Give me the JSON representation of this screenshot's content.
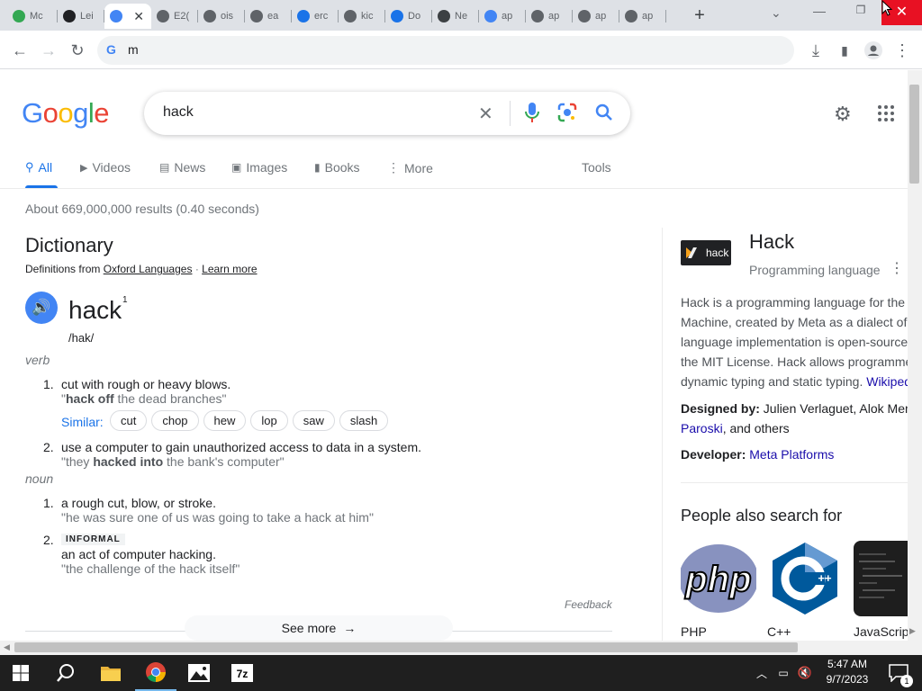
{
  "browser": {
    "tabs": [
      {
        "label": "Mc",
        "color": "#34a853"
      },
      {
        "label": "Lei",
        "color": "#202124"
      },
      {
        "label": "",
        "color": "#4285f4",
        "active": true
      },
      {
        "label": "E2(",
        "color": "#5f6368"
      },
      {
        "label": "ois",
        "color": "#5f6368"
      },
      {
        "label": "ea",
        "color": "#5f6368"
      },
      {
        "label": "erc",
        "color": "#1a73e8"
      },
      {
        "label": "kic",
        "color": "#5f6368"
      },
      {
        "label": "Do",
        "color": "#1a73e8"
      },
      {
        "label": "Ne",
        "color": "#3c4043"
      },
      {
        "label": "ap",
        "color": "#4285f4"
      },
      {
        "label": "ap",
        "color": "#5f6368"
      },
      {
        "label": "ap",
        "color": "#5f6368"
      },
      {
        "label": "ap",
        "color": "#5f6368"
      }
    ],
    "new_tab": "+",
    "close_tab": "✕",
    "omnibox_text": "m"
  },
  "search": {
    "logo": [
      "G",
      "o",
      "o",
      "g",
      "l",
      "e"
    ],
    "logo_colors": [
      "#4285f4",
      "#ea4335",
      "#fbbc05",
      "#4285f4",
      "#34a853",
      "#ea4335"
    ],
    "query": "hack",
    "tabs": [
      "All",
      "Videos",
      "News",
      "Images",
      "Books",
      "More"
    ],
    "tools": "Tools",
    "stats": "About 669,000,000 results (0.40 seconds)"
  },
  "dictionary": {
    "title": "Dictionary",
    "defs_from": "Definitions from",
    "source": "Oxford Languages",
    "learn_more": "Learn more",
    "word": "hack",
    "sup": "1",
    "phonetic": "/hak/",
    "verb_label": "verb",
    "verb_defs": [
      {
        "num": "1.",
        "def": "cut with rough or heavy blows.",
        "ex_pre": "\"",
        "ex_bold": "hack off",
        "ex_post": " the dead branches\""
      },
      {
        "num": "2.",
        "def": "use a computer to gain unauthorized access to data in a system.",
        "ex_pre": "\"they ",
        "ex_bold": "hacked into",
        "ex_post": " the bank's computer\""
      }
    ],
    "similar_label": "Similar:",
    "similar": [
      "cut",
      "chop",
      "hew",
      "lop",
      "saw",
      "slash"
    ],
    "noun_label": "noun",
    "noun_defs": [
      {
        "num": "1.",
        "def": "a rough cut, blow, or stroke.",
        "ex": "\"he was sure one of us was going to take a hack at him\""
      },
      {
        "num": "2.",
        "tag": "INFORMAL",
        "def": "an act of computer hacking.",
        "ex": "\"the challenge of the hack itself\""
      }
    ],
    "feedback": "Feedback",
    "see_more": "See more"
  },
  "knowledge_panel": {
    "logo_text": "hack",
    "title": "Hack",
    "subtitle": "Programming language",
    "desc": [
      "Hack is a programming language for the",
      "Machine, created by Meta as a dialect of",
      "language implementation is open-source",
      "the MIT License. Hack allows programme",
      "dynamic typing and static typing."
    ],
    "wiki": "Wikiped",
    "designed_label": "Designed by:",
    "designed_value": "Julien Verlaguet, Alok Men",
    "designed_value2": "Paroski",
    "designed_tail": ", and others",
    "developer_label": "Developer:",
    "developer_value": "Meta Platforms",
    "people_title": "People also search for",
    "people": [
      "PHP",
      "C++",
      "JavaScrip"
    ]
  },
  "taskbar": {
    "time": "5:47 AM",
    "date": "9/7/2023",
    "notif": "1"
  }
}
